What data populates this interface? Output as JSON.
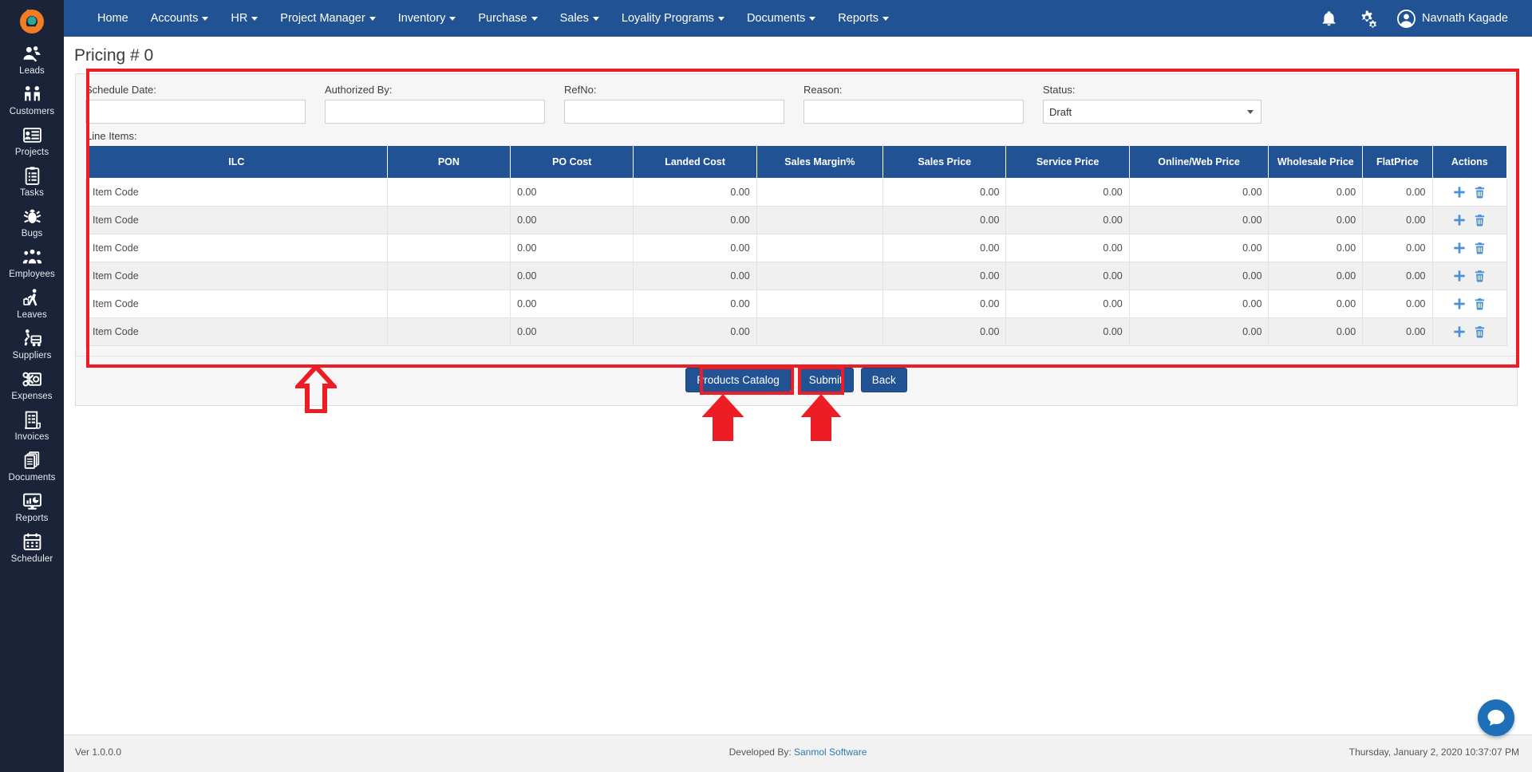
{
  "app": {
    "logo_icon": "brand-logo-icon"
  },
  "topnav": {
    "items": [
      {
        "label": "Home",
        "caret": false
      },
      {
        "label": "Accounts",
        "caret": true
      },
      {
        "label": "HR",
        "caret": true
      },
      {
        "label": "Project Manager",
        "caret": true
      },
      {
        "label": "Inventory",
        "caret": true
      },
      {
        "label": "Purchase",
        "caret": true
      },
      {
        "label": "Sales",
        "caret": true
      },
      {
        "label": "Loyality Programs",
        "caret": true
      },
      {
        "label": "Documents",
        "caret": true
      },
      {
        "label": "Reports",
        "caret": true
      }
    ],
    "bell_icon": "notification-bell-icon",
    "settings_icon": "gears-settings-icon",
    "avatar_icon": "user-avatar-icon",
    "user_name": "Navnath Kagade"
  },
  "sidebar": {
    "items": [
      {
        "label": "Leads",
        "icon": "leads-icon"
      },
      {
        "label": "Customers",
        "icon": "customers-icon"
      },
      {
        "label": "Projects",
        "icon": "projects-icon"
      },
      {
        "label": "Tasks",
        "icon": "tasks-clipboard-icon"
      },
      {
        "label": "Bugs",
        "icon": "bug-icon"
      },
      {
        "label": "Employees",
        "icon": "employees-icon"
      },
      {
        "label": "Leaves",
        "icon": "leaves-traveller-icon"
      },
      {
        "label": "Suppliers",
        "icon": "suppliers-icon"
      },
      {
        "label": "Expenses",
        "icon": "expenses-scissors-icon"
      },
      {
        "label": "Invoices",
        "icon": "invoice-icon"
      },
      {
        "label": "Documents",
        "icon": "documents-icon"
      },
      {
        "label": "Reports",
        "icon": "reports-monitor-icon"
      },
      {
        "label": "Scheduler",
        "icon": "scheduler-calendar-icon"
      }
    ]
  },
  "page": {
    "title": "Pricing # 0"
  },
  "form": {
    "fields": [
      {
        "label": "Schedule Date:",
        "value": "",
        "placeholder": "",
        "type": "text",
        "name": "schedule-date-field"
      },
      {
        "label": "Authorized By:",
        "value": "",
        "placeholder": "",
        "type": "text",
        "name": "authorized-by-field"
      },
      {
        "label": "RefNo:",
        "value": "",
        "placeholder": "",
        "type": "text",
        "name": "refno-field"
      },
      {
        "label": "Reason:",
        "value": "",
        "placeholder": "",
        "type": "text",
        "name": "reason-field"
      }
    ],
    "status": {
      "label": "Status:",
      "value": "Draft",
      "options": [
        "Draft"
      ]
    }
  },
  "lineitems": {
    "label": "Line Items:",
    "columns": [
      "ILC",
      "PON",
      "PO Cost",
      "Landed Cost",
      "Sales Margin%",
      "Sales Price",
      "Service Price",
      "Online/Web Price",
      "Wholesale Price",
      "FlatPrice",
      "Actions"
    ],
    "rows": [
      {
        "ilc": "Item Code",
        "pon": "",
        "po_cost": "0.00",
        "landed_cost": "0.00",
        "sales_margin": "",
        "sales_price": "0.00",
        "service_price": "0.00",
        "online_web_price": "0.00",
        "wholesale_price": "0.00",
        "flat_price": "0.00"
      },
      {
        "ilc": "Item Code",
        "pon": "",
        "po_cost": "0.00",
        "landed_cost": "0.00",
        "sales_margin": "",
        "sales_price": "0.00",
        "service_price": "0.00",
        "online_web_price": "0.00",
        "wholesale_price": "0.00",
        "flat_price": "0.00"
      },
      {
        "ilc": "Item Code",
        "pon": "",
        "po_cost": "0.00",
        "landed_cost": "0.00",
        "sales_margin": "",
        "sales_price": "0.00",
        "service_price": "0.00",
        "online_web_price": "0.00",
        "wholesale_price": "0.00",
        "flat_price": "0.00"
      },
      {
        "ilc": "Item Code",
        "pon": "",
        "po_cost": "0.00",
        "landed_cost": "0.00",
        "sales_margin": "",
        "sales_price": "0.00",
        "service_price": "0.00",
        "online_web_price": "0.00",
        "wholesale_price": "0.00",
        "flat_price": "0.00"
      },
      {
        "ilc": "Item Code",
        "pon": "",
        "po_cost": "0.00",
        "landed_cost": "0.00",
        "sales_margin": "",
        "sales_price": "0.00",
        "service_price": "0.00",
        "online_web_price": "0.00",
        "wholesale_price": "0.00",
        "flat_price": "0.00"
      },
      {
        "ilc": "Item Code",
        "pon": "",
        "po_cost": "0.00",
        "landed_cost": "0.00",
        "sales_margin": "",
        "sales_price": "0.00",
        "service_price": "0.00",
        "online_web_price": "0.00",
        "wholesale_price": "0.00",
        "flat_price": "0.00"
      }
    ],
    "row_actions": {
      "add_icon": "add-row-icon",
      "delete_icon": "delete-row-icon"
    }
  },
  "buttons": {
    "products_catalog": "Products Catalog",
    "submit": "Submit",
    "back": "Back"
  },
  "chat": {
    "icon": "chat-bubble-icon"
  },
  "footer": {
    "version": "Ver 1.0.0.0",
    "developed_by_label": "Developed By:",
    "developer": "Sanmol Software",
    "timestamp": "Thursday, January 2, 2020 10:37:07 PM"
  },
  "annotations": {
    "highlight_color": "#ee1c25",
    "regions": [
      "line-items-panel",
      "products-catalog-button",
      "submit-button"
    ],
    "arrows": [
      "arrow-to-line-items",
      "arrow-to-products-catalog",
      "arrow-to-submit"
    ]
  }
}
